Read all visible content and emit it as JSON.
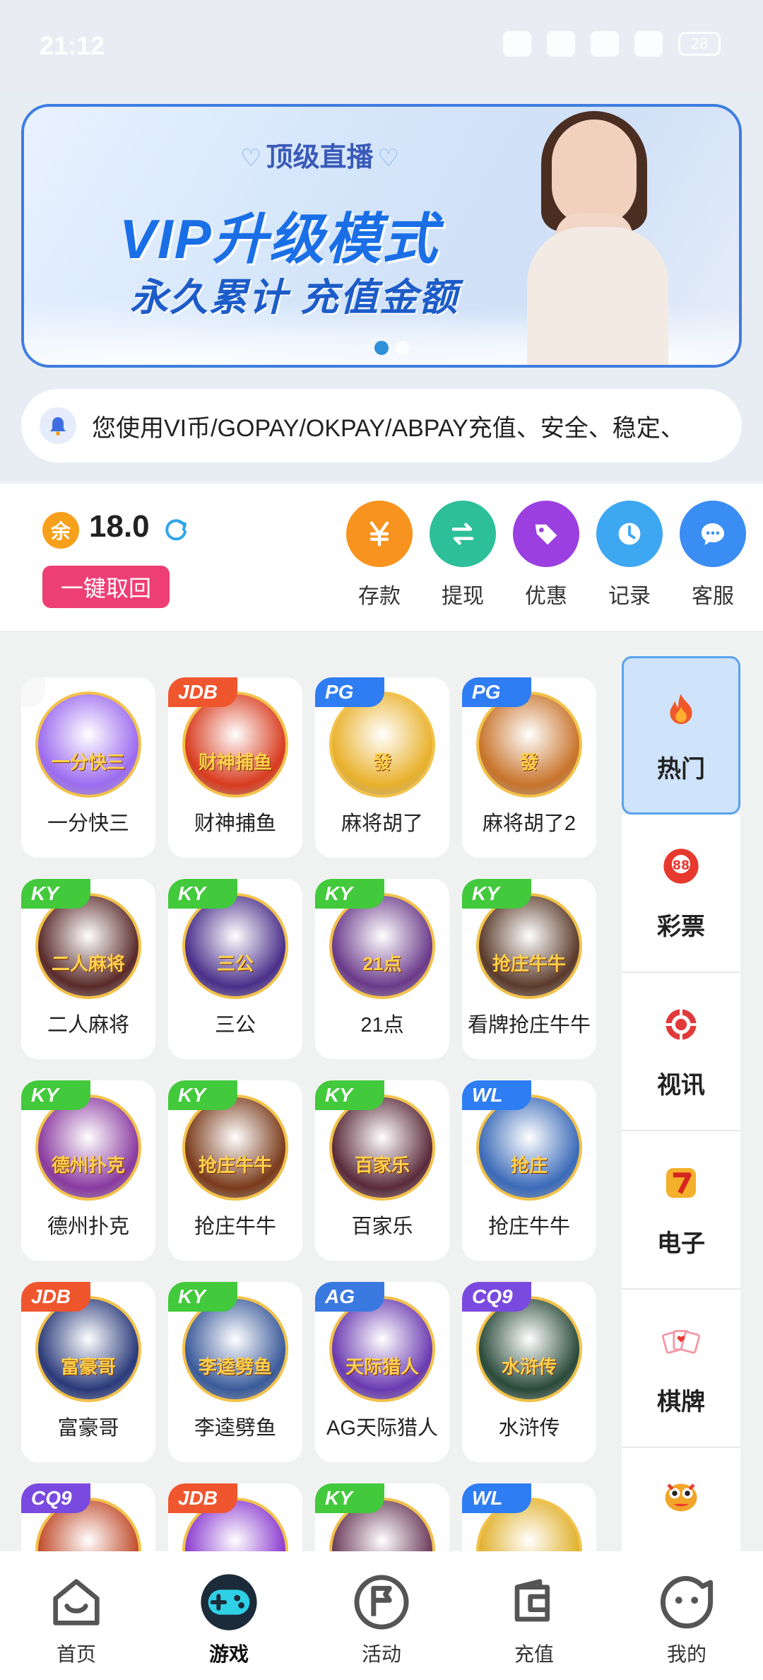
{
  "status_bar": {
    "time": "21:12",
    "battery": "28"
  },
  "banner": {
    "tag": "顶级直播",
    "headline": "VIP升级模式",
    "subline": "永久累计 充值金额",
    "slide_index": 1,
    "slide_count": 2
  },
  "notice": {
    "text": "您使用VI币/GOPAY/OKPAY/ABPAY充值、安全、稳定、"
  },
  "wallet": {
    "balance_icon": "余",
    "balance": "18.0",
    "withdraw_all_label": "一键取回",
    "actions": [
      {
        "label": "存款",
        "icon": "yen-icon",
        "color": "#f7931e"
      },
      {
        "label": "提现",
        "icon": "transfer-icon",
        "color": "#2cbf9a"
      },
      {
        "label": "优惠",
        "icon": "tag-icon",
        "color": "#9b3fe0"
      },
      {
        "label": "记录",
        "icon": "clock-icon",
        "color": "#3ea7f2"
      },
      {
        "label": "客服",
        "icon": "chat-icon",
        "color": "#3a8df2"
      }
    ]
  },
  "games": [
    {
      "name": "一分快三",
      "badge": "",
      "badge_color": "#f3f3f3",
      "art_text": "一分快三",
      "art_color": "#9c6bf0"
    },
    {
      "name": "财神捕鱼",
      "badge": "JDB",
      "badge_color": "#f0562e",
      "art_text": "财神捕鱼",
      "art_color": "#d83b1e"
    },
    {
      "name": "麻将胡了",
      "badge": "PG",
      "badge_color": "#2f7df2",
      "art_text": "發",
      "art_color": "#e9b12c"
    },
    {
      "name": "麻将胡了2",
      "badge": "PG",
      "badge_color": "#2f7df2",
      "art_text": "發",
      "art_color": "#c8732a"
    },
    {
      "name": "二人麻将",
      "badge": "KY",
      "badge_color": "#42c93c",
      "art_text": "二人麻将",
      "art_color": "#5a2a2a"
    },
    {
      "name": "三公",
      "badge": "KY",
      "badge_color": "#42c93c",
      "art_text": "三公",
      "art_color": "#4a2f8a"
    },
    {
      "name": "21点",
      "badge": "KY",
      "badge_color": "#42c93c",
      "art_text": "21点",
      "art_color": "#6a3a8a"
    },
    {
      "name": "看牌抢庄牛牛",
      "badge": "KY",
      "badge_color": "#42c93c",
      "art_text": "抢庄牛牛",
      "art_color": "#5a3a2a"
    },
    {
      "name": "德州扑克",
      "badge": "KY",
      "badge_color": "#42c93c",
      "art_text": "德州扑克",
      "art_color": "#8a3aa0"
    },
    {
      "name": "抢庄牛牛",
      "badge": "KY",
      "badge_color": "#42c93c",
      "art_text": "抢庄牛牛",
      "art_color": "#7a3a1a"
    },
    {
      "name": "百家乐",
      "badge": "KY",
      "badge_color": "#42c93c",
      "art_text": "百家乐",
      "art_color": "#5a2a3a"
    },
    {
      "name": "抢庄牛牛",
      "badge": "WL",
      "badge_color": "#2f7df2",
      "art_text": "抢庄",
      "art_color": "#3a6ab8"
    },
    {
      "name": "富豪哥",
      "badge": "JDB",
      "badge_color": "#f0562e",
      "art_text": "富豪哥",
      "art_color": "#2a3a7a"
    },
    {
      "name": "李逵劈鱼",
      "badge": "KY",
      "badge_color": "#42c93c",
      "art_text": "李逵劈鱼",
      "art_color": "#3a5a9a"
    },
    {
      "name": "AG天际猎人",
      "badge": "AG",
      "badge_color": "#3a7ae0",
      "art_text": "天际猎人",
      "art_color": "#6a3ab0"
    },
    {
      "name": "水浒传",
      "badge": "CQ9",
      "badge_color": "#7a4ae0",
      "art_text": "水浒传",
      "art_color": "#2a4a3a"
    },
    {
      "name": "",
      "badge": "CQ9",
      "badge_color": "#7a4ae0",
      "art_text": "",
      "art_color": "#c04a2a"
    },
    {
      "name": "",
      "badge": "JDB",
      "badge_color": "#f0562e",
      "art_text": "",
      "art_color": "#8a3ad0"
    },
    {
      "name": "",
      "badge": "KY",
      "badge_color": "#42c93c",
      "art_text": "",
      "art_color": "#6a3a5a"
    },
    {
      "name": "",
      "badge": "WL",
      "badge_color": "#2f7df2",
      "art_text": "",
      "art_color": "#e0b02a"
    }
  ],
  "categories": [
    {
      "label": "热门",
      "icon": "fire-icon",
      "active": true
    },
    {
      "label": "彩票",
      "icon": "lottery-ball-icon",
      "active": false
    },
    {
      "label": "视讯",
      "icon": "poker-chip-icon",
      "active": false
    },
    {
      "label": "电子",
      "icon": "slot-seven-icon",
      "active": false
    },
    {
      "label": "棋牌",
      "icon": "cards-icon",
      "active": false
    },
    {
      "label": "",
      "icon": "fish-icon",
      "active": false
    }
  ],
  "bottom_nav": [
    {
      "label": "首页",
      "icon": "home-icon",
      "active": false
    },
    {
      "label": "游戏",
      "icon": "gamepad-icon",
      "active": true
    },
    {
      "label": "活动",
      "icon": "flag-icon",
      "active": false
    },
    {
      "label": "充值",
      "icon": "wallet-icon",
      "active": false
    },
    {
      "label": "我的",
      "icon": "profile-icon",
      "active": false
    }
  ]
}
